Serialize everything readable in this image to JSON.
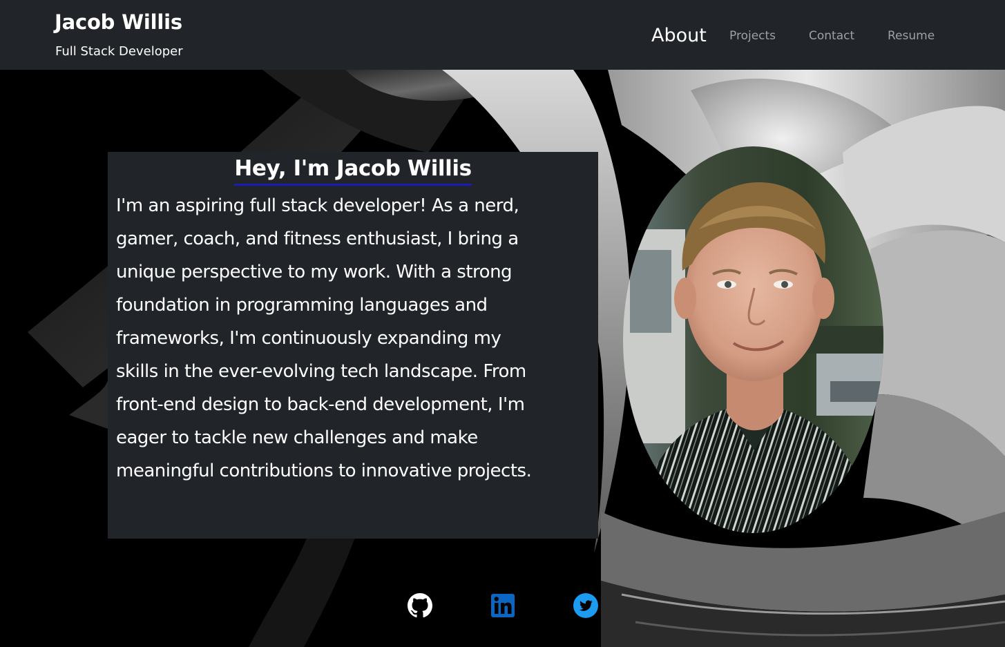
{
  "header": {
    "name": "Jacob Willis",
    "subtitle": "Full Stack Developer",
    "nav": [
      {
        "label": "About",
        "active": true
      },
      {
        "label": "Projects",
        "active": false
      },
      {
        "label": "Contact",
        "active": false
      },
      {
        "label": "Resume",
        "active": false
      }
    ]
  },
  "about": {
    "heading": "Hey, I'm Jacob Willis",
    "lines": [
      "I'm an aspiring full stack developer! As a nerd,",
      "gamer, coach, and fitness enthusiast, I bring a",
      "unique perspective to my work. With a strong",
      "foundation in programming languages and",
      "frameworks, I'm continuously expanding my",
      "skills in the ever-evolving tech landscape. From",
      "front-end design to back-end development, I'm",
      "eager to tackle new challenges and make",
      "meaningful contributions to innovative projects."
    ]
  },
  "social": [
    {
      "icon": "github-icon",
      "color": "#ffffff"
    },
    {
      "icon": "linkedin-icon",
      "color": "#0a66c2"
    },
    {
      "icon": "twitter-icon",
      "color": "#1d9bf0"
    }
  ],
  "colors": {
    "header_bg": "#212529",
    "card_bg": "#212529",
    "heading_underline": "#1b1bb8",
    "nav_inactive": "#9ca1a6"
  }
}
